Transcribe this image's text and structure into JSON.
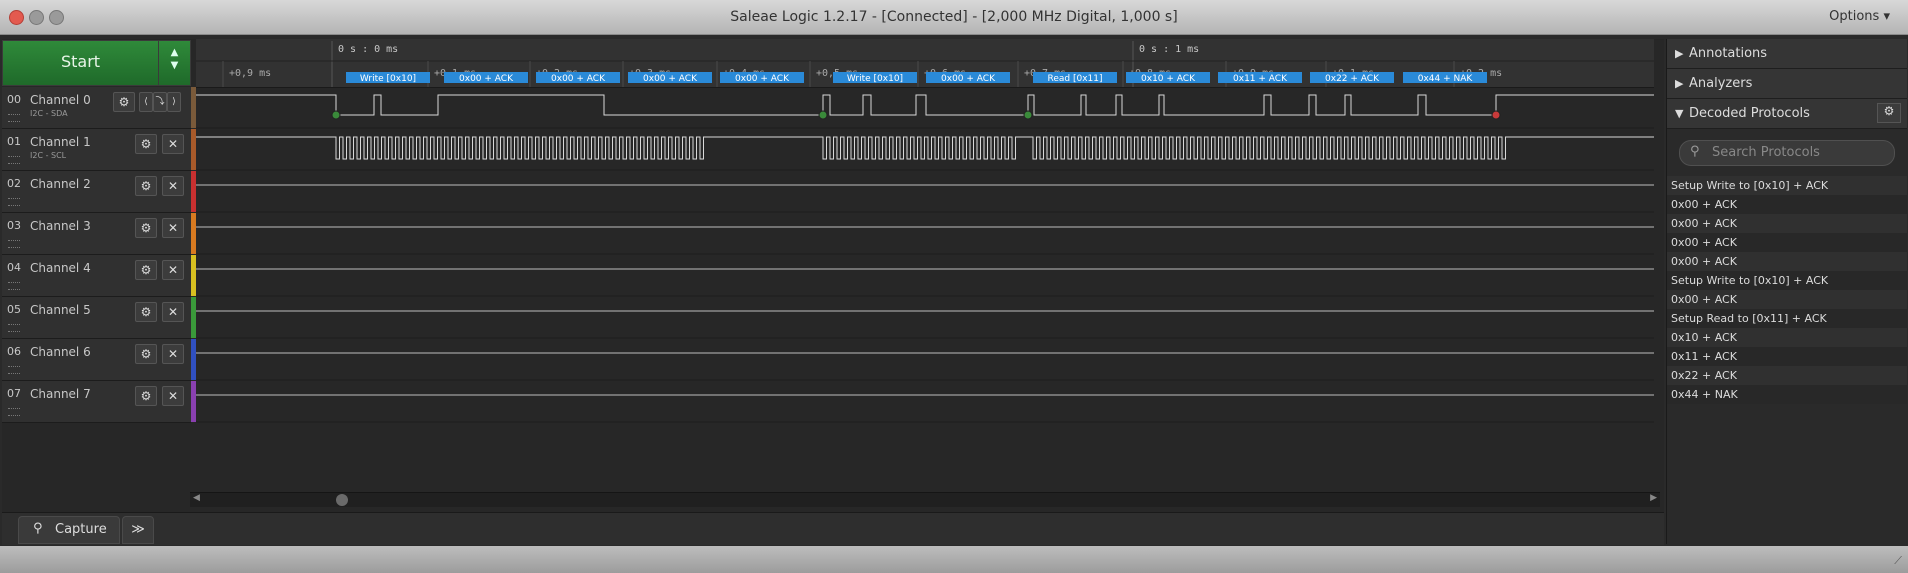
{
  "window": {
    "title": "Saleae Logic 1.2.17 - [Connected] - [2,000 MHz Digital, 1,000 s]",
    "options_label": "Options"
  },
  "controls": {
    "start_label": "Start"
  },
  "ruler": {
    "top_labels": [
      "0 s : 0 ms",
      "0 s : 1 ms"
    ],
    "ticks": [
      "+0,9 ms",
      "+0,1 ms",
      "+0,2 ms",
      "+0,3 ms",
      "+0,4 ms",
      "+0,5 ms",
      "+0,6 ms",
      "+0,7 ms",
      "+0,8 ms",
      "+0,9 ms",
      "+0,1 ms",
      "+0,2 ms"
    ]
  },
  "channels": [
    {
      "num": "00",
      "name": "Channel 0",
      "sub": "I2C - SDA",
      "color": "#7a5a3a"
    },
    {
      "num": "01",
      "name": "Channel 1",
      "sub": "I2C - SCL",
      "color": "#a85a2a"
    },
    {
      "num": "02",
      "name": "Channel 2",
      "sub": "",
      "color": "#c83030"
    },
    {
      "num": "03",
      "name": "Channel 3",
      "sub": "",
      "color": "#d87a20"
    },
    {
      "num": "04",
      "name": "Channel 4",
      "sub": "",
      "color": "#d8c020"
    },
    {
      "num": "05",
      "name": "Channel 5",
      "sub": "",
      "color": "#3a9a3a"
    },
    {
      "num": "06",
      "name": "Channel 6",
      "sub": "",
      "color": "#3050c0"
    },
    {
      "num": "07",
      "name": "Channel 7",
      "sub": "",
      "color": "#8a40b0"
    }
  ],
  "decoded_bubbles": [
    "Write [0x10]",
    "0x00 + ACK",
    "0x00 + ACK",
    "0x00 + ACK",
    "0x00 + ACK",
    "Write [0x10]",
    "0x00 + ACK",
    "Read [0x11]",
    "0x10 + ACK",
    "0x11 + ACK",
    "0x22 + ACK",
    "0x44 + NAK"
  ],
  "tabs": {
    "capture_label": "Capture",
    "more_label": "≫"
  },
  "right_panel": {
    "annotations_label": "Annotations",
    "analyzers_label": "Analyzers",
    "decoded_label": "Decoded Protocols",
    "search_placeholder": "Search Protocols",
    "protocols": [
      "Setup Write to [0x10] + ACK",
      "0x00 + ACK",
      "0x00 + ACK",
      "0x00 + ACK",
      "0x00 + ACK",
      "Setup Write to [0x10] + ACK",
      "0x00 + ACK",
      "Setup Read to [0x11] + ACK",
      "0x10 + ACK",
      "0x11 + ACK",
      "0x22 + ACK",
      "0x44 + NAK"
    ]
  },
  "colors": {
    "accent_green": "#2f8a3a",
    "bubble_blue": "#2a8ad8"
  }
}
